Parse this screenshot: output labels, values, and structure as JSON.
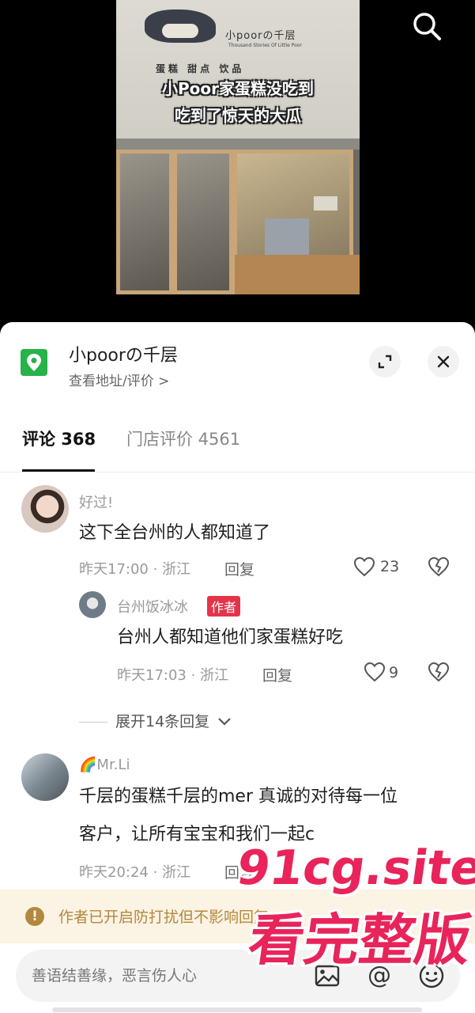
{
  "video": {
    "caption_line1": "小Poor家蛋糕没吃到",
    "caption_line2": "吃到了惊天的大瓜",
    "sign_name": "小poorの千层",
    "sign_subtitle": "Thousand Stories Of Little Poor",
    "sign_menu": "蛋糕 甜点 饮品",
    "search_icon": "search-icon"
  },
  "store": {
    "name": "小poorの千层",
    "link": "查看地址/评价 >",
    "pin_icon": "location-pin-icon",
    "expand_icon": "expand-icon",
    "close_icon": "close-icon",
    "accent_color": "#27b24a"
  },
  "tabs": {
    "comments": "评论 368",
    "reviews": "门店评价 4561"
  },
  "comments": [
    {
      "user": "好过!",
      "text": "这下全台州的人都知道了",
      "time": "昨天17:00 · 浙江",
      "reply": "回复",
      "likes": "23"
    },
    {
      "user": "台州饭冰冰",
      "badge": "作者",
      "text": "台州人都知道他们家蛋糕好吃",
      "time": "昨天17:03 · 浙江",
      "reply": "回复",
      "likes": "9"
    },
    {
      "user": "🌈Mr.Li",
      "text_line1": "千层的蛋糕千层的mer 真诚的对待每一位",
      "text_line2": "客户，让所有宝宝和我们一起c",
      "time": "昨天20:24 · 浙江",
      "reply": "回复"
    }
  ],
  "expand_replies": "展开14条回复",
  "notice": {
    "text": "作者已开启防打扰但不影响回复",
    "color": "#b2883d"
  },
  "input": {
    "placeholder": "善语结善缘，恶言伤人心"
  },
  "watermark": {
    "line1": "91cg.site",
    "line2": "看完整版",
    "color": "#e8245a"
  }
}
